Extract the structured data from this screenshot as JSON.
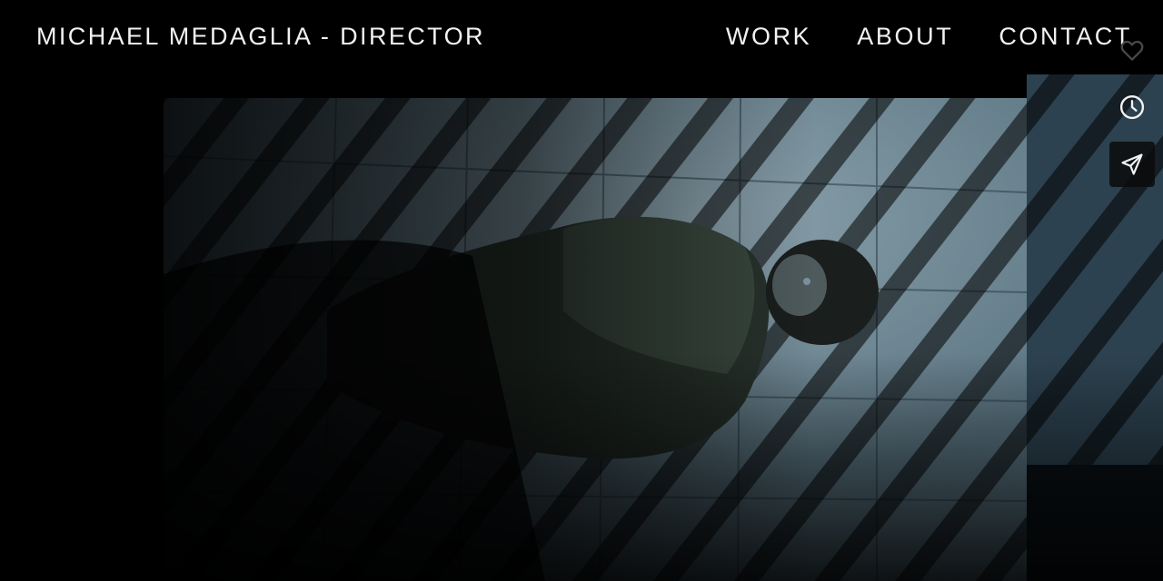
{
  "header": {
    "site_title": "MICHAEL MEDAGLIA - DIRECTOR",
    "nav": [
      {
        "label": "WORK"
      },
      {
        "label": "ABOUT"
      },
      {
        "label": "CONTACT"
      }
    ]
  },
  "side_actions": [
    {
      "icon": "heart-icon",
      "action": "like"
    },
    {
      "icon": "clock-icon",
      "action": "watch-later"
    },
    {
      "icon": "send-icon",
      "action": "share"
    }
  ],
  "colors": {
    "background": "#000000",
    "text": "#f2f2f2",
    "mattress_light": "#8fa6b3",
    "mattress_shadow": "#1c2a30"
  }
}
